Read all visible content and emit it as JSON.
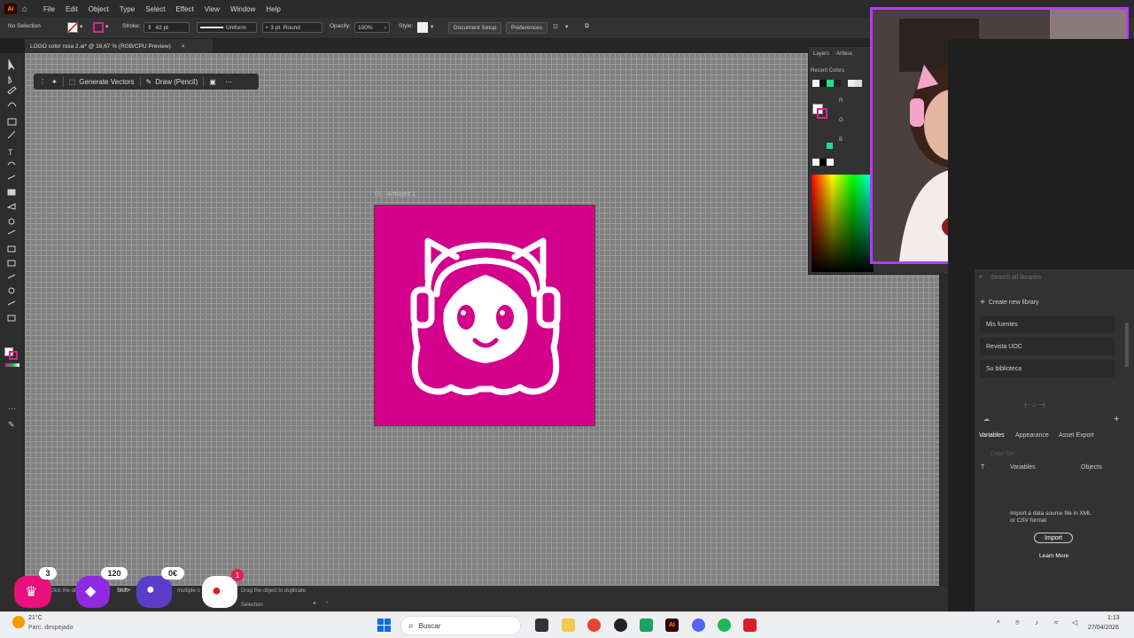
{
  "menubar": {
    "app_logo": "Ai",
    "items": [
      "File",
      "Edit",
      "Object",
      "Type",
      "Select",
      "Effect",
      "View",
      "Window",
      "Help"
    ]
  },
  "controlbar": {
    "selection": "No Selection",
    "stroke_label": "Stroke:",
    "stroke_value": "42 pt",
    "uniform": "Uniform",
    "brush": "3 pt. Round",
    "opacity_label": "Opacity:",
    "opacity_value": "100%",
    "style_label": "Style:",
    "document_setup": "Document Setup",
    "preferences": "Preferences"
  },
  "document": {
    "tab_title": "LOGO color rosa 2.ai* @ 16,67 % (RGB/CPU Preview)",
    "artboard_label": "01 - Artboard 1",
    "artboard_color": "#d2008a"
  },
  "context_bar": {
    "generate_vectors": "Generate Vectors",
    "draw_mode": "Draw (Pencil)"
  },
  "color_panel": {
    "tabs": [
      "Layers",
      "Artboa"
    ],
    "recent_colors_label": "Recent Colors",
    "channels": [
      "R",
      "G",
      "B"
    ]
  },
  "libraries": {
    "search_placeholder": "Search all libraries",
    "create_label": "Create new library",
    "items": [
      "Mis fuentes",
      "Revista UOC",
      "Su biblioteca"
    ]
  },
  "variables_panel": {
    "tabs": [
      "Variables",
      "Appearance",
      "Asset Export"
    ],
    "data_set_label": "Data Set:",
    "columns": [
      "T",
      "Variables",
      "Objects"
    ],
    "import_text": "Import a data source file in XML or CSV format",
    "import_button": "Import",
    "learn_more": "Learn More"
  },
  "status": {
    "hint_left": "Click the ob",
    "hint_shift": "Shift+",
    "hint_multiple": "multiple o",
    "hint_drag": "Drag the object to duplicate",
    "mode": "Selection"
  },
  "overlay": {
    "badge1": "3",
    "badge2": "120",
    "badge3": "0€",
    "badge4": "1"
  },
  "taskbar": {
    "weather_temp": "21°C",
    "weather_desc": "Parc. despejado",
    "search_placeholder": "Buscar",
    "time": "1:13",
    "date": "27/04/2026"
  }
}
